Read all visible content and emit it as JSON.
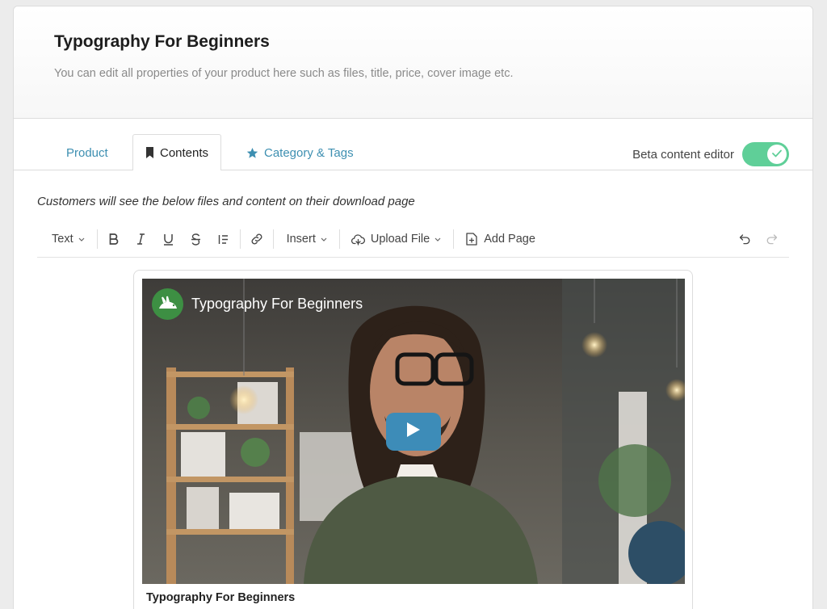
{
  "header": {
    "title": "Typography For Beginners",
    "subtitle": "You can edit all properties of your product here such as files, title, price, cover image etc."
  },
  "tabs": [
    {
      "label": "Product",
      "active": false
    },
    {
      "label": "Contents",
      "active": true,
      "icon": "bookmark-icon"
    },
    {
      "label": "Category & Tags",
      "active": false,
      "icon": "star-icon"
    }
  ],
  "beta_toggle": {
    "label": "Beta content editor",
    "on": true
  },
  "instructions": "Customers will see the below files and content on their download page",
  "toolbar": {
    "text_style": "Text",
    "insert": "Insert",
    "upload_file": "Upload File",
    "add_page": "Add Page"
  },
  "video": {
    "title": "Typography For Beginners",
    "caption": "Typography For Beginners"
  },
  "colors": {
    "accent": "#3d8fb1",
    "toggle_on": "#5fcf98",
    "play_button": "#3d8cb8"
  }
}
